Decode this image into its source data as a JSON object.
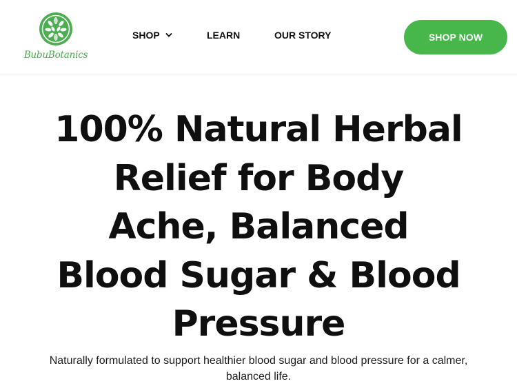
{
  "brand": {
    "name": "BubuBotanics",
    "logo_icon": "leaf-wreath-icon",
    "accent_color": "#47b74c"
  },
  "nav": {
    "items": [
      {
        "label": "SHOP",
        "has_dropdown": true
      },
      {
        "label": "LEARN",
        "has_dropdown": false
      },
      {
        "label": "OUR STORY",
        "has_dropdown": false
      }
    ],
    "cta_label": "SHOP NOW"
  },
  "hero": {
    "title_lines": [
      "100% Natural Herbal",
      "Relief for Body",
      "Ache, Balanced",
      "Blood Sugar & Blood",
      "Pressure"
    ],
    "subtitle": "Naturally formulated to support healthier blood sugar and blood pressure for a calmer, balanced life."
  }
}
